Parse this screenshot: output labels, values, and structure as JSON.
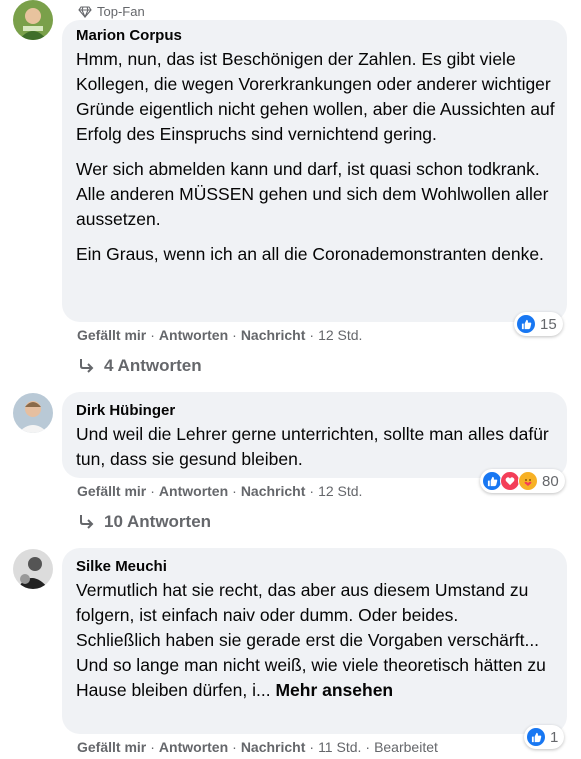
{
  "comments": [
    {
      "badge": "Top-Fan",
      "author": "Marion Corpus",
      "paragraphs": [
        "Hmm, nun, das ist Beschönigen der Zahlen. Es gibt viele Kollegen, die wegen Vorerkrankungen oder anderer wichtiger Gründe eigentlich nicht gehen wollen, aber die Aussichten auf Erfolg des Einspruchs sind vernichtend gering.",
        "Wer sich abmelden kann und darf, ist quasi schon todkrank. Alle anderen MÜSSEN gehen und sich dem Wohlwollen aller aussetzen.",
        "Ein Graus, wenn ich an all die Coronademonstranten denke."
      ],
      "like": "Gefällt mir",
      "reply": "Antworten",
      "message": "Nachricht",
      "time": "12 Std.",
      "reactions": "15",
      "replies": "4 Antworten"
    },
    {
      "author": "Dirk Hübinger",
      "paragraphs": [
        "Und weil die Lehrer gerne unterrichten, sollte man alles dafür tun, dass sie gesund bleiben."
      ],
      "like": "Gefällt mir",
      "reply": "Antworten",
      "message": "Nachricht",
      "time": "12 Std.",
      "reactions": "80",
      "replies": "10 Antworten"
    },
    {
      "author": "Silke Meuchi",
      "paragraphs": [
        "Vermutlich hat sie recht, das aber aus diesem Umstand zu folgern, ist einfach naiv oder dumm. Oder beides. Schließlich haben sie gerade erst die Vorgaben verschärft...",
        "Und so lange man nicht weiß, wie viele theoretisch hätten zu Hause bleiben dürfen, i..."
      ],
      "see_more": "Mehr ansehen",
      "like": "Gefällt mir",
      "reply": "Antworten",
      "message": "Nachricht",
      "time": "11 Std.",
      "edited": "Bearbeitet",
      "reactions": "1"
    }
  ],
  "colors": {
    "bubble": "#f0f2f5",
    "meta": "#65676b",
    "like_blue": "#1877f2",
    "love_red": "#f33e58",
    "care_yellow": "#f7b125"
  }
}
